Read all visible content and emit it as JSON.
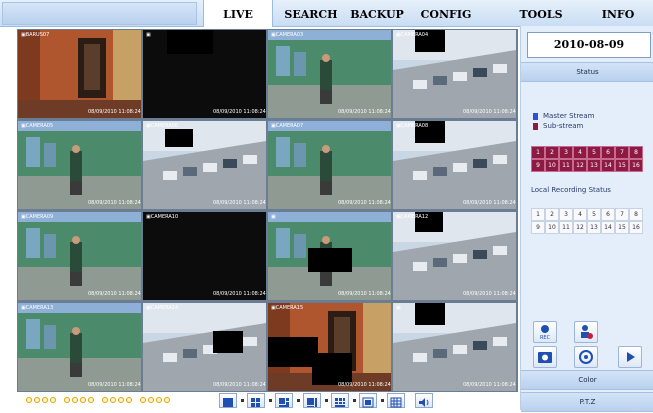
{
  "menu": {
    "tabs": [
      {
        "label": "LIVE",
        "active": true
      },
      {
        "label": "SEARCH",
        "active": false
      },
      {
        "label": "BACKUP",
        "active": false
      },
      {
        "label": "CONFIG",
        "active": false
      },
      {
        "label": "TOOLS",
        "active": false
      },
      {
        "label": "INFO",
        "active": false
      }
    ]
  },
  "datetime": "2010-08-09 11:08:24",
  "cameras": [
    {
      "label": "BARUS07",
      "timestamp": "08/09/2010 11:08:24",
      "scene": "hall",
      "selected": true
    },
    {
      "label": "",
      "timestamp": "08/09/2010 11:08:24",
      "scene": "dark",
      "selected": false
    },
    {
      "label": "CAMERA03",
      "timestamp": "08/09/2010 11:08:24",
      "scene": "street",
      "selected": false
    },
    {
      "label": "CAMERA04",
      "timestamp": "08/09/2010 11:08:24",
      "scene": "parking",
      "selected": false
    },
    {
      "label": "CAMERA05",
      "timestamp": "08/09/2010 11:08:24",
      "scene": "street",
      "selected": false
    },
    {
      "label": "CAMERA06",
      "timestamp": "08/09/2010 11:08:24",
      "scene": "parking",
      "selected": false
    },
    {
      "label": "CAMERA07",
      "timestamp": "08/09/2010 11:08:24",
      "scene": "street",
      "selected": false
    },
    {
      "label": "CAMERA08",
      "timestamp": "08/09/2010 11:08:24",
      "scene": "parking",
      "selected": false
    },
    {
      "label": "CAMERA09",
      "timestamp": "08/09/2010 11:08:24",
      "scene": "street",
      "selected": false
    },
    {
      "label": "CAMERA10",
      "timestamp": "08/09/2010 11:08:24",
      "scene": "dark",
      "selected": false
    },
    {
      "label": "",
      "timestamp": "08/09/2010 11:08:24",
      "scene": "street",
      "selected": false
    },
    {
      "label": "CAMERA12",
      "timestamp": "08/09/2010 11:08:24",
      "scene": "parking",
      "selected": false
    },
    {
      "label": "CAMERA13",
      "timestamp": "08/09/2010 11:08:24",
      "scene": "street",
      "selected": false
    },
    {
      "label": "CAMERA14",
      "timestamp": "08/09/2010 11:08:24",
      "scene": "parking",
      "selected": false
    },
    {
      "label": "CAMERA15",
      "timestamp": "08/09/2010 11:08:24",
      "scene": "hall",
      "selected": false
    },
    {
      "label": "",
      "timestamp": "08/09/2010 11:08:24",
      "scene": "parking",
      "selected": false
    }
  ],
  "sidebar": {
    "status_title": "Status",
    "legend": [
      {
        "label": "Master Stream",
        "color": "#2f4fd1"
      },
      {
        "label": "Sub-stream",
        "color": "#8c1a43"
      }
    ],
    "stream_channels": [
      "1",
      "2",
      "3",
      "4",
      "5",
      "6",
      "7",
      "8",
      "9",
      "10",
      "11",
      "12",
      "13",
      "14",
      "15",
      "16"
    ],
    "recording_title": "Local Recording Status",
    "recording_channels": [
      "1",
      "2",
      "3",
      "4",
      "5",
      "6",
      "7",
      "8",
      "9",
      "10",
      "11",
      "12",
      "13",
      "14",
      "15",
      "16"
    ],
    "buttons": [
      {
        "icon": "record-icon"
      },
      {
        "icon": "manual-alarm-icon"
      },
      {
        "icon": "snapshot-icon"
      },
      {
        "icon": "ptz-scan-icon"
      },
      {
        "icon": "play-icon"
      }
    ],
    "color_label": "Color",
    "ptz_label": "P.T.Z"
  },
  "bottom": {
    "channel_dot_groups": 4,
    "dots_per_group": 4,
    "layouts": [
      "layout-1-icon",
      "layout-4-icon",
      "layout-6-icon",
      "layout-8-icon",
      "layout-9-icon",
      "layout-13-icon",
      "layout-16-icon"
    ],
    "audio_icon": "speaker-icon"
  },
  "colors": {
    "accent": "#3b5bd6",
    "sub_stream": "#8c1a43",
    "panel": "#e3eefa"
  }
}
